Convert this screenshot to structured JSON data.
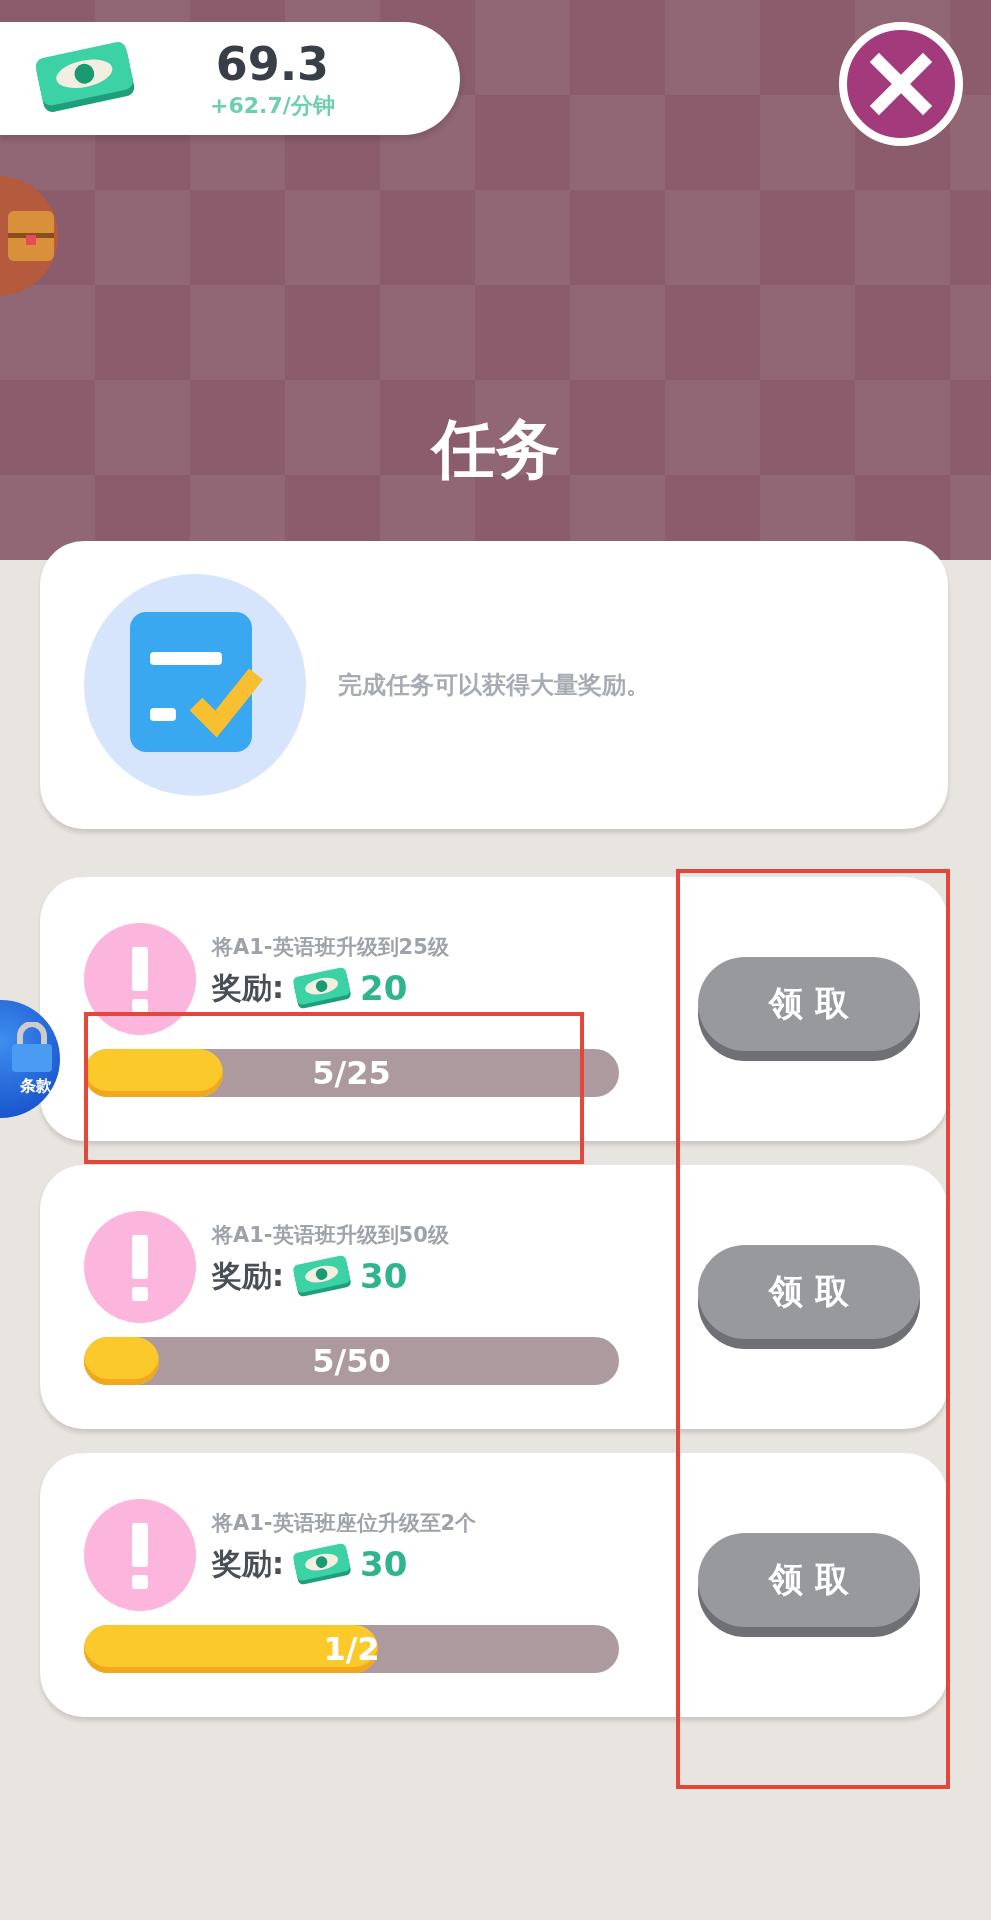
{
  "currency": {
    "amount": "69.3",
    "rate": "+62.7/分钟"
  },
  "title": "任务",
  "intro": {
    "text": "完成任务可以获得大量奖励。"
  },
  "side_badge": {
    "label": "条款"
  },
  "tasks": [
    {
      "title": "将A1-英语班升级到25级",
      "reward_label": "奖励:",
      "reward_amount": "20",
      "progress": "5/25",
      "level": 0.26,
      "button": "领 取",
      "highlight_progress": true
    },
    {
      "title": "将A1-英语班升级到50级",
      "reward_label": "奖励:",
      "reward_amount": "30",
      "progress": "5/50",
      "level": 0.14,
      "button": "领 取",
      "highlight_progress": false
    },
    {
      "title": "将A1-英语班座位升级至2个",
      "reward_label": "奖励:",
      "reward_amount": "30",
      "progress": "1/2",
      "level": 0.55,
      "button": "领 取",
      "highlight_progress": false
    }
  ]
}
